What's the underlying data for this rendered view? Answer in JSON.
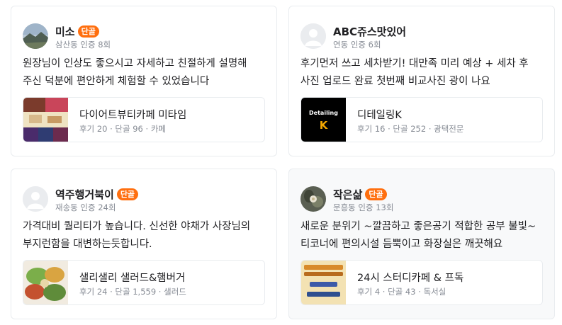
{
  "badge_label": "단골",
  "reviews": [
    {
      "nickname": "미소",
      "regular": true,
      "sub": "삼산동 인증 8회",
      "text": "원장님이 인상도 좋으시고 자세하고 친절하게 설명해 주신 덕분에 편안하게 체험할 수 있었습니다",
      "store": {
        "name": "다이어트뷰티카페 미타임",
        "meta": "후기 20 · 단골 96 · 카페"
      }
    },
    {
      "nickname": "ABC쥬스맛있어",
      "regular": false,
      "sub": "연동 인증 6회",
      "text": "후기먼저 쓰고 세차받기! 대만족 미리 예상 + 세차 후 사진 업로드 완료 첫번째 비교사진 광이 나요",
      "store": {
        "name": "디테일링K",
        "meta": "후기 16 · 단골 252 · 광택전문",
        "thumb_text": "Detailing",
        "thumb_letter": "K"
      }
    },
    {
      "nickname": "역주행거북이",
      "regular": true,
      "sub": "재송동 인증 24회",
      "text": "가격대비 퀄리티가 높습니다. 신선한 야채가 사장님의 부지런함을 대변하는듯합니다.",
      "store": {
        "name": "샐리샐리 샐러드&햄버거",
        "meta": "후기 24 · 단골 1,559 · 샐러드"
      }
    },
    {
      "nickname": "작은삶",
      "regular": true,
      "sub": "문흥동 인증 13회",
      "text": "새로운 분위기 ~깔끔하고 좋은공기 적합한 공부 불빛~ 티코너에 편의시설 듬뿍이고 화장실은 깨끗해요",
      "store": {
        "name": "24시 스터디카페 & 프독",
        "meta": "후기 4 · 단골 43 · 독서실"
      }
    }
  ]
}
